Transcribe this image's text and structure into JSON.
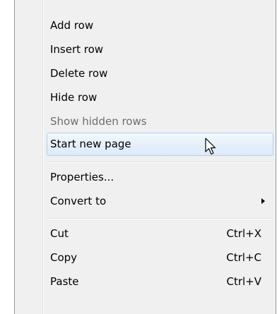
{
  "context_menu": {
    "items": [
      {
        "label": "Add row"
      },
      {
        "label": "Insert row"
      },
      {
        "label": "Delete row"
      },
      {
        "label": "Hide row"
      },
      {
        "label": "Show hidden rows",
        "state": "disabled"
      },
      {
        "label": "Start new page",
        "state": "highlighted"
      },
      {
        "label": "Properties..."
      },
      {
        "label": "Convert to",
        "submenu": true
      },
      {
        "label": "Cut",
        "shortcut": "Ctrl+X"
      },
      {
        "label": "Copy",
        "shortcut": "Ctrl+C"
      },
      {
        "label": "Paste",
        "shortcut": "Ctrl+V"
      }
    ]
  },
  "cursor": {
    "icon": "mouse-pointer-icon"
  },
  "colors": {
    "menu_background": "#f0f0f0",
    "highlight_border": "#aecff7",
    "highlight_fill": "#e6f0fb",
    "disabled_text": "#6d6d6d",
    "menu_border": "#979797"
  }
}
